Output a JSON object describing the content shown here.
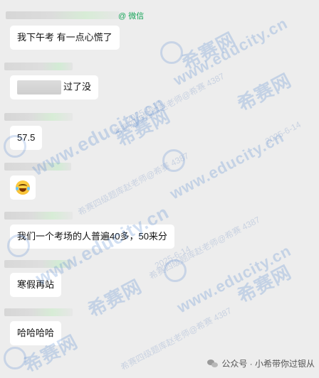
{
  "wechat_tag": "@ 微信",
  "messages": [
    {
      "text": "我下午考 有一点心慌了"
    },
    {
      "text": "过了没"
    },
    {
      "text": "57.5"
    },
    {
      "emoji": "crying-laughing-emoji"
    },
    {
      "text": "我们一个考场的人普遍40多，50来分"
    },
    {
      "text": "寒假再站"
    },
    {
      "text": "哈哈哈哈"
    }
  ],
  "watermark": {
    "brand": "希赛网",
    "site": "www.educity.cn",
    "teacher": "希赛四级题库赵老师@希赛 4387",
    "date": "2025-6-14"
  },
  "footer": {
    "label": "公众号 · 小希带你过银从"
  }
}
